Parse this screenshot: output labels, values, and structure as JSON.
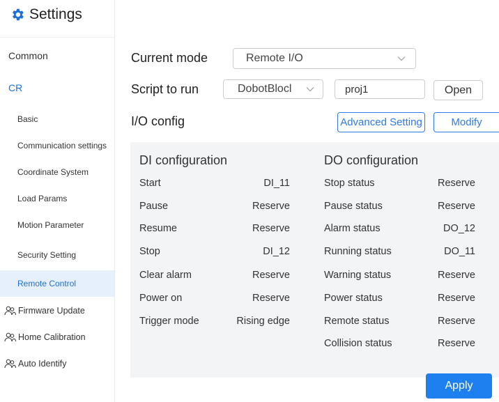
{
  "sidebar": {
    "title": "Settings",
    "items": [
      {
        "label": "Common"
      },
      {
        "label": "CR"
      },
      {
        "label": "Basic"
      },
      {
        "label": "Communication settings"
      },
      {
        "label": "Coordinate System"
      },
      {
        "label": "Load Params"
      },
      {
        "label": "Motion Parameter"
      },
      {
        "label": "Security Setting"
      },
      {
        "label": "Remote Control"
      },
      {
        "label": "Firmware Update"
      },
      {
        "label": "Home Calibration"
      },
      {
        "label": "Auto Identify"
      }
    ]
  },
  "main": {
    "current_mode_label": "Current mode",
    "current_mode_value": "Remote I/O",
    "script_label": "Script to run",
    "script_select_value": "DobotBlocl",
    "script_input_value": "proj1",
    "open_label": "Open",
    "io_config_label": "I/O config",
    "advanced_label": "Advanced Setting",
    "modify_label": "Modify",
    "apply_label": "Apply"
  },
  "di": {
    "title": "DI configuration",
    "rows": [
      {
        "name": "Start",
        "value": "DI_11"
      },
      {
        "name": "Pause",
        "value": "Reserve"
      },
      {
        "name": "Resume",
        "value": "Reserve"
      },
      {
        "name": "Stop",
        "value": "DI_12"
      },
      {
        "name": "Clear alarm",
        "value": "Reserve"
      },
      {
        "name": "Power on",
        "value": "Reserve"
      },
      {
        "name": "Trigger mode",
        "value": "Rising edge"
      }
    ]
  },
  "do": {
    "title": "DO configuration",
    "rows": [
      {
        "name": "Stop status",
        "value": "Reserve"
      },
      {
        "name": "Pause status",
        "value": "Reserve"
      },
      {
        "name": "Alarm status",
        "value": "DO_12"
      },
      {
        "name": "Running status",
        "value": "DO_11"
      },
      {
        "name": "Warning status",
        "value": "Reserve"
      },
      {
        "name": "Power status",
        "value": "Reserve"
      },
      {
        "name": "Remote status",
        "value": "Reserve"
      },
      {
        "name": "Collision status",
        "value": "Reserve"
      }
    ]
  }
}
